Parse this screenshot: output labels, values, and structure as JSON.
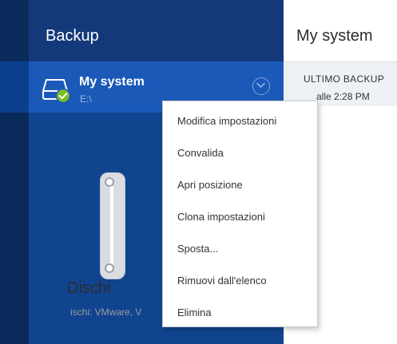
{
  "sidebar": {
    "title": "Backup",
    "backup_item": {
      "name": "My system",
      "path": "E:\\",
      "icon": "drive-check-icon",
      "status_color": "#7bbd20"
    }
  },
  "main": {
    "title": "My system",
    "last_backup_label": "ULTIMO BACKUP",
    "last_backup_time": "alle 2:28 PM",
    "destination_name": "Dischi",
    "destination_desc": "ischi: VMware, V"
  },
  "context_menu": {
    "items": [
      {
        "label": "Modifica impostazioni"
      },
      {
        "label": "Convalida"
      },
      {
        "label": "Apri posizione"
      },
      {
        "label": "Clona impostazioni"
      },
      {
        "label": "Sposta..."
      },
      {
        "label": "Rimuovi dall'elenco"
      },
      {
        "label": "Elimina"
      }
    ]
  },
  "colors": {
    "nav_rail": "#0b2a5c",
    "sidebar": "#11448f",
    "selected_item": "#1a59b8",
    "accent_check": "#7bbd20"
  }
}
